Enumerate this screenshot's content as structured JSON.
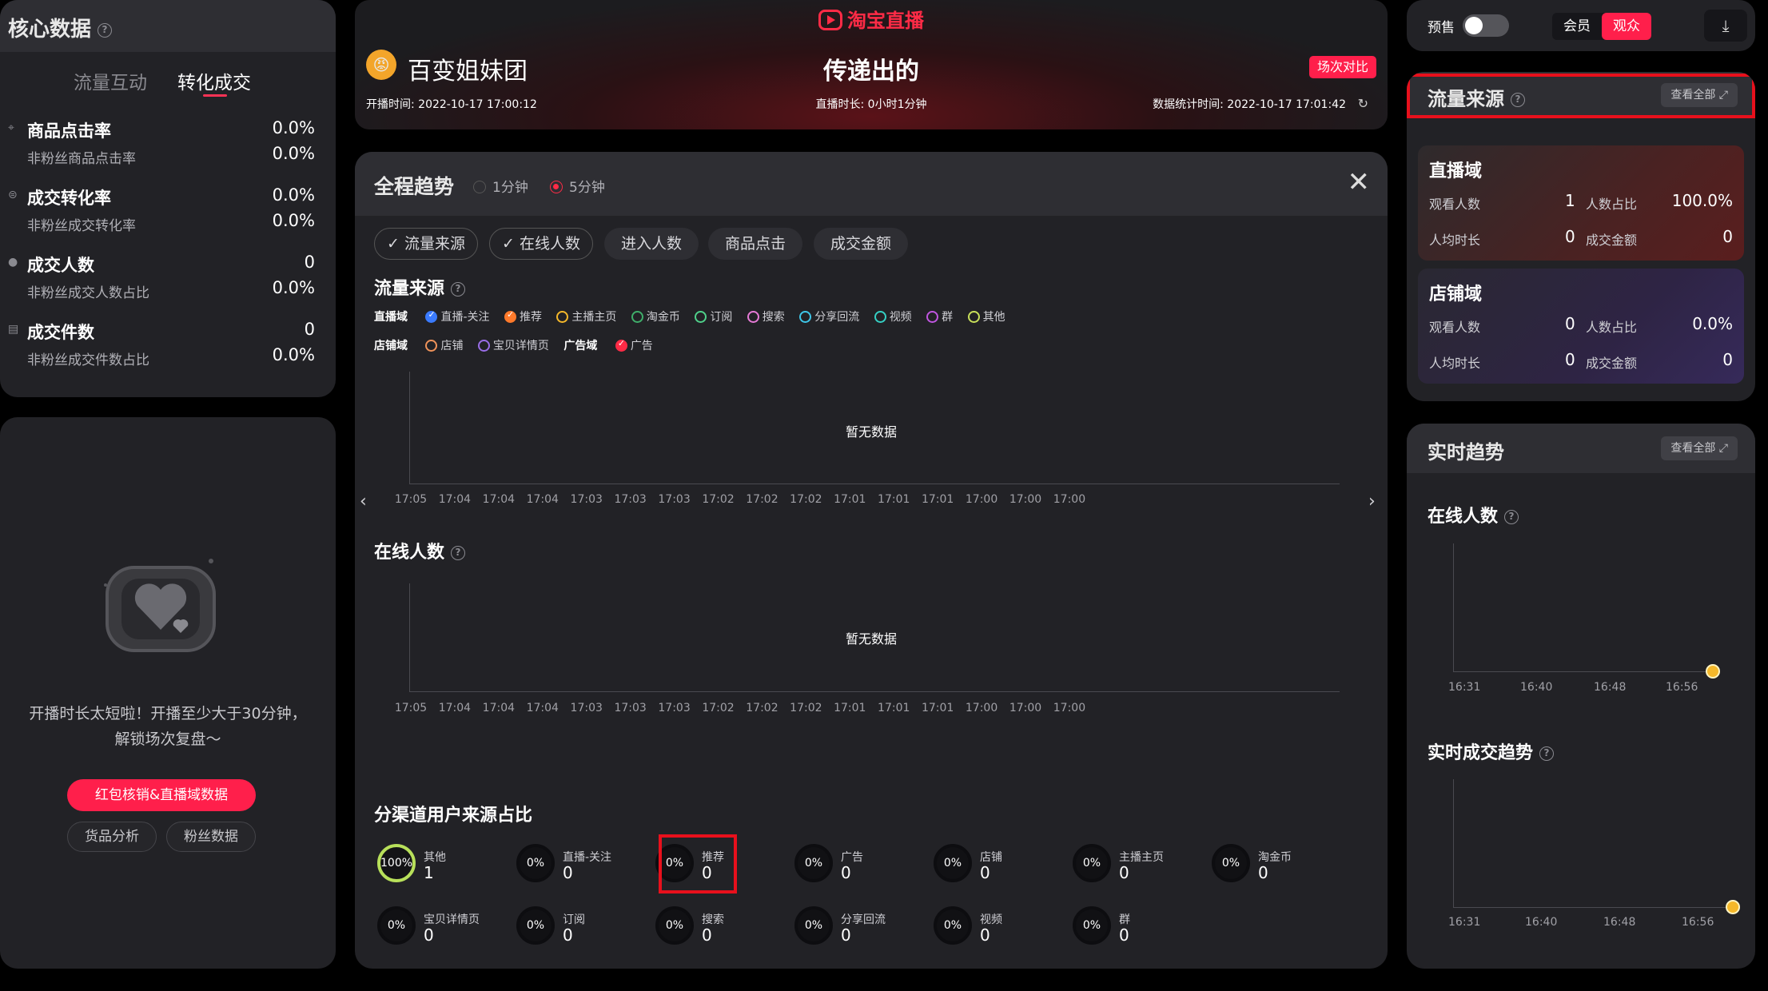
{
  "core": {
    "title": "核心数据",
    "tabs": [
      "流量互动",
      "转化成交"
    ],
    "metrics": [
      {
        "name": "商品点击率",
        "value": "0.0%",
        "sub": "非粉丝商品点击率",
        "sub_value": "0.0%"
      },
      {
        "name": "成交转化率",
        "value": "0.0%",
        "sub": "非粉丝成交转化率",
        "sub_value": "0.0%"
      },
      {
        "name": "成交人数",
        "value": "0",
        "sub": "非粉丝成交人数占比",
        "sub_value": "0.0%"
      },
      {
        "name": "成交件数",
        "value": "0",
        "sub": "非粉丝成交件数占比",
        "sub_value": "0.0%"
      }
    ]
  },
  "replay": {
    "message_line1": "开播时长太短啦！开播至少大于30分钟，",
    "message_line2": "解锁场次复盘～",
    "main_button": "红包核销&直播域数据",
    "btn_goods": "货品分析",
    "btn_fans": "粉丝数据"
  },
  "live": {
    "brand": "淘宝直播",
    "shop": "百变姐妹团",
    "title": "传递出的",
    "compare": "场次对比",
    "start_time": "开播时间: 2022-10-17 17:00:12",
    "duration": "直播时长: 0小时1分钟",
    "stat_time": "数据统计时间: 2022-10-17 17:01:42"
  },
  "trend": {
    "title": "全程趋势",
    "radio_1": "1分钟",
    "radio_5": "5分钟",
    "pills": [
      "流量来源",
      "在线人数",
      "进入人数",
      "商品点击",
      "成交金额"
    ],
    "section_traffic": "流量来源",
    "legend_live_group": "直播域",
    "legend_live": [
      "直播-关注",
      "推荐",
      "主播主页",
      "淘金币",
      "订阅",
      "搜索",
      "分享回流",
      "视频",
      "群",
      "其他"
    ],
    "legend_shop_group": "店铺域",
    "legend_shop": [
      "店铺",
      "宝贝详情页"
    ],
    "legend_ad_group": "广告域",
    "legend_ad": [
      "广告"
    ],
    "empty": "暂无数据",
    "ticks": [
      "17:05",
      "17:04",
      "17:04",
      "17:04",
      "17:03",
      "17:03",
      "17:03",
      "17:02",
      "17:02",
      "17:02",
      "17:01",
      "17:01",
      "17:01",
      "17:00",
      "17:00",
      "17:00"
    ],
    "section_online": "在线人数",
    "section_channels": "分渠道用户来源占比",
    "channels": [
      {
        "name": "其他",
        "pct": "100%",
        "value": "1"
      },
      {
        "name": "直播-关注",
        "pct": "0%",
        "value": "0"
      },
      {
        "name": "推荐",
        "pct": "0%",
        "value": "0"
      },
      {
        "name": "广告",
        "pct": "0%",
        "value": "0"
      },
      {
        "name": "店铺",
        "pct": "0%",
        "value": "0"
      },
      {
        "name": "主播主页",
        "pct": "0%",
        "value": "0"
      },
      {
        "name": "淘金币",
        "pct": "0%",
        "value": "0"
      },
      {
        "name": "宝贝详情页",
        "pct": "0%",
        "value": "0"
      },
      {
        "name": "订阅",
        "pct": "0%",
        "value": "0"
      },
      {
        "name": "搜索",
        "pct": "0%",
        "value": "0"
      },
      {
        "name": "分享回流",
        "pct": "0%",
        "value": "0"
      },
      {
        "name": "视频",
        "pct": "0%",
        "value": "0"
      },
      {
        "name": "群",
        "pct": "0%",
        "value": "0"
      }
    ]
  },
  "top": {
    "presale": "预售",
    "seg_member": "会员",
    "seg_audience": "观众"
  },
  "source": {
    "title": "流量来源",
    "view_all": "查看全部",
    "live_domain": {
      "title": "直播域",
      "viewers_label": "观看人数",
      "viewers": "1",
      "ratio_label": "人数占比",
      "ratio": "100.0%",
      "dur_label": "人均时长",
      "dur": "0",
      "gmv_label": "成交金额",
      "gmv": "0"
    },
    "shop_domain": {
      "title": "店铺域",
      "viewers_label": "观看人数",
      "viewers": "0",
      "ratio_label": "人数占比",
      "ratio": "0.0%",
      "dur_label": "人均时长",
      "dur": "0",
      "gmv_label": "成交金额",
      "gmv": "0"
    }
  },
  "realtime": {
    "title": "实时趋势",
    "view_all": "查看全部",
    "online_title": "在线人数",
    "deal_title": "实时成交趋势",
    "ticks": [
      "16:31",
      "16:40",
      "16:48",
      "16:56"
    ]
  },
  "colors": {
    "accent": "#ff1f4b",
    "highlight": "#e8101c",
    "live_domain_bg": "#4a2222",
    "shop_domain_bg": "#2e2444",
    "point": "#f5b82a"
  }
}
